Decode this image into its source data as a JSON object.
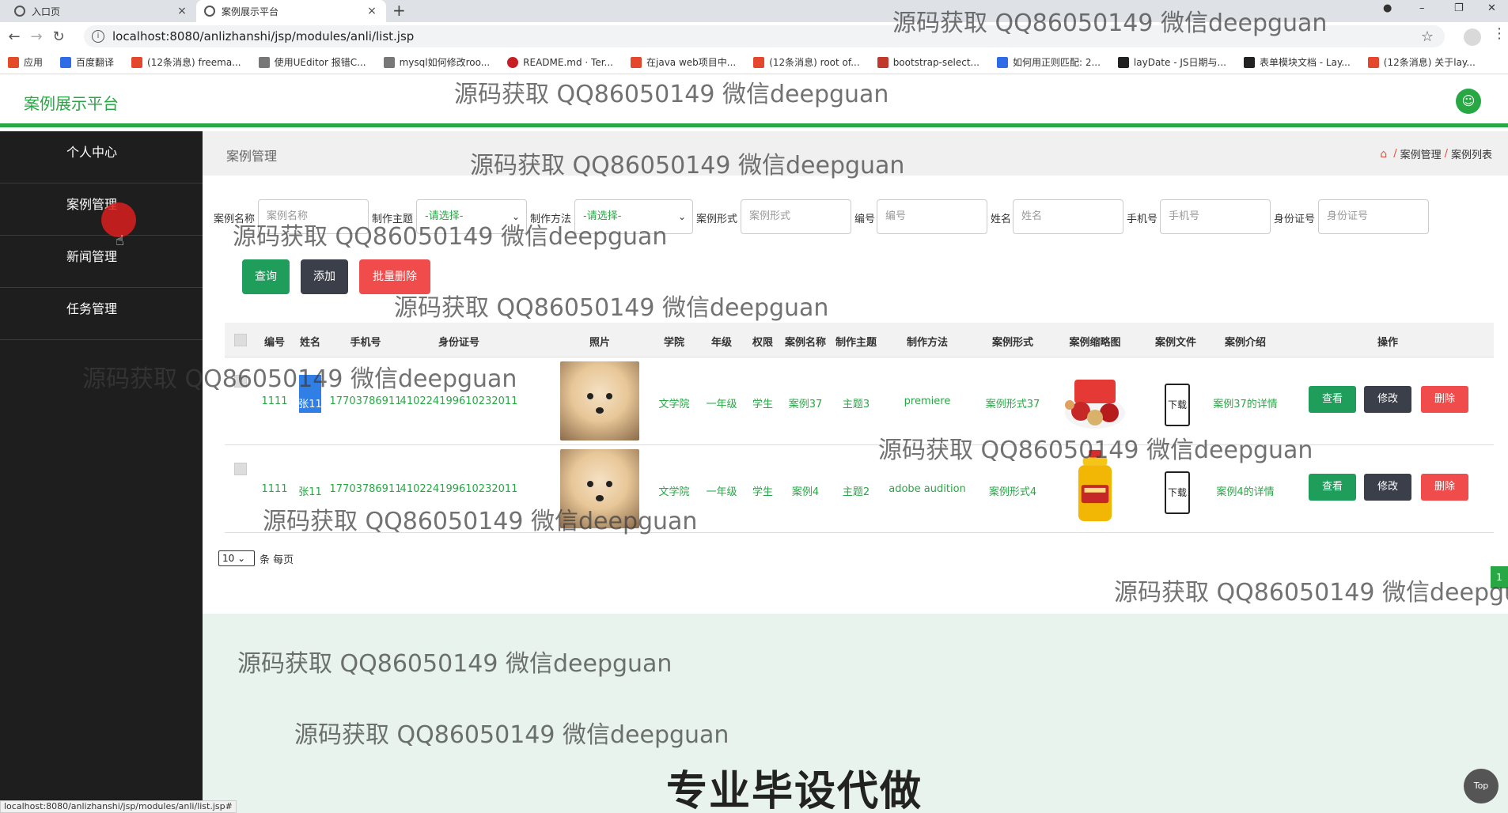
{
  "browser": {
    "tabs": [
      {
        "label": "入口页",
        "close": "×"
      },
      {
        "label": "案例展示平台",
        "close": "×"
      }
    ],
    "new_tab": "+",
    "url": "localhost:8080/anlizhanshi/jsp/modules/anli/list.jsp",
    "status_url": "localhost:8080/anlizhanshi/jsp/modules/anli/list.jsp#",
    "bookmarks": [
      {
        "label": "应用",
        "color": "#e34c26"
      },
      {
        "label": "百度翻译",
        "color": "#2e6be6"
      },
      {
        "label": "(12条消息) freema...",
        "color": "#e5472d"
      },
      {
        "label": "使用UEditor 报错C...",
        "color": "#555555"
      },
      {
        "label": "mysql如何修改roo...",
        "color": "#555555"
      },
      {
        "label": "README.md · Ter...",
        "color": "#c71d23"
      },
      {
        "label": "在java web项目中...",
        "color": "#e5472d"
      },
      {
        "label": "(12条消息) root of...",
        "color": "#e5472d"
      },
      {
        "label": "bootstrap-select...",
        "color": "#c0392b"
      },
      {
        "label": "如何用正则匹配: 2...",
        "color": "#2e6be6"
      },
      {
        "label": "layDate - JS日期与...",
        "color": "#222222"
      },
      {
        "label": "表单模块文档 - Lay...",
        "color": "#222222"
      },
      {
        "label": "(12条消息) 关于lay...",
        "color": "#e5472d"
      }
    ]
  },
  "header": {
    "brand": "案例展示平台"
  },
  "sidebar": {
    "items": [
      {
        "label": "个人中心"
      },
      {
        "label": "案例管理"
      },
      {
        "label": "新闻管理"
      },
      {
        "label": "任务管理"
      }
    ]
  },
  "main": {
    "title": "案例管理",
    "breadcrumb": [
      "案例管理",
      "案例列表"
    ],
    "filters": [
      {
        "label": "案例名称",
        "placeholder": "案例名称"
      },
      {
        "label": "制作主题",
        "placeholder": "-请选择-"
      },
      {
        "label": "制作方法",
        "placeholder": "-请选择-"
      },
      {
        "label": "案例形式",
        "placeholder": "案例形式"
      },
      {
        "label": "编号",
        "placeholder": "编号"
      },
      {
        "label": "姓名",
        "placeholder": "姓名"
      },
      {
        "label": "手机号",
        "placeholder": "手机号"
      },
      {
        "label": "身份证号",
        "placeholder": "身份证号"
      }
    ],
    "buttons": {
      "search": "查询",
      "add": "添加",
      "batch_delete": "批量删除"
    },
    "table": {
      "headers": [
        "编号",
        "姓名",
        "手机号",
        "身份证号",
        "照片",
        "学院",
        "年级",
        "权限",
        "案例名称",
        "制作主题",
        "制作方法",
        "案例形式",
        "案例缩略图",
        "案例文件",
        "案例介绍",
        "操作"
      ],
      "rows": [
        {
          "id": "1111",
          "name": "张11",
          "phone": "17703786911",
          "idcard": "410224199610232011",
          "college": "文学院",
          "grade": "一年级",
          "role": "学生",
          "case_name": "案例37",
          "theme": "主题3",
          "method": "premiere",
          "form": "案例形式37",
          "file": "下载",
          "intro": "案例37的详情",
          "view": "查看",
          "edit": "修改",
          "del": "删除"
        },
        {
          "id": "1111",
          "name": "张11",
          "phone": "17703786911",
          "idcard": "410224199610232011",
          "college": "文学院",
          "grade": "一年级",
          "role": "学生",
          "case_name": "案例4",
          "theme": "主题2",
          "method": "adobe audition",
          "form": "案例形式4",
          "file": "下载",
          "intro": "案例4的详情",
          "view": "查看",
          "edit": "修改",
          "del": "删除"
        }
      ]
    },
    "pager": {
      "page_size": "10",
      "per_page_label": "条 每页",
      "current_page": "1"
    }
  },
  "footer": {
    "promo": "专业毕设代做",
    "top_button": "Top"
  },
  "watermark": "源码获取 QQ86050149 微信deepguan",
  "colors": {
    "accent": "#28a745",
    "danger": "#f14c4c",
    "dark": "#3b3f4a",
    "sidebar": "#1e1e1e"
  }
}
